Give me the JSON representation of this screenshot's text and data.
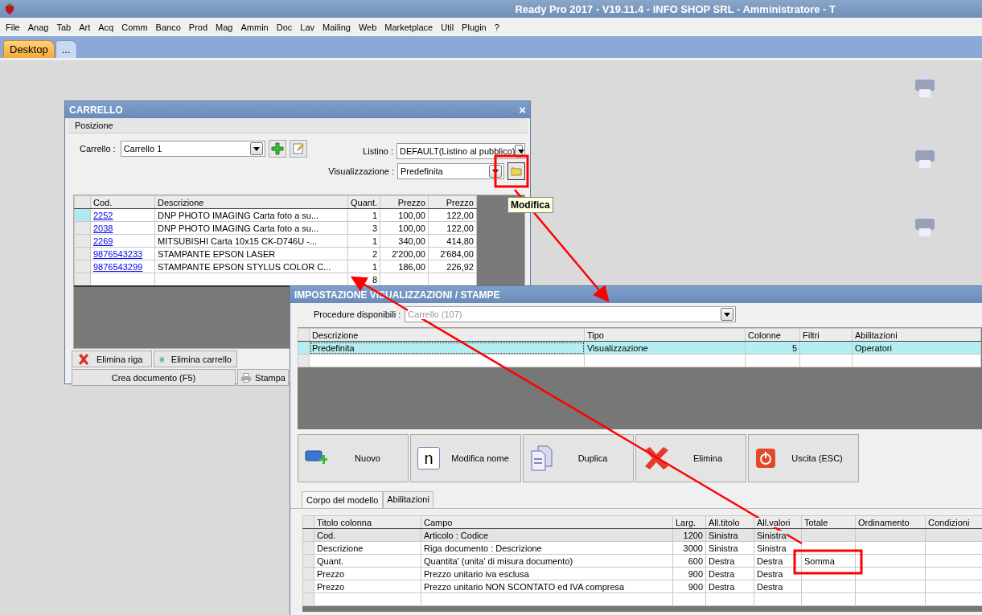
{
  "window": {
    "title": "Ready Pro 2017 - V19.11.4 - INFO SHOP SRL - Amministratore - T"
  },
  "menu": [
    "File",
    "Anag",
    "Tab",
    "Art",
    "Acq",
    "Comm",
    "Banco",
    "Prod",
    "Mag",
    "Ammin",
    "Doc",
    "Lav",
    "Mailing",
    "Web",
    "Marketplace",
    "Util",
    "Plugin",
    "?"
  ],
  "tabs": [
    {
      "label": "Desktop",
      "selected": true
    },
    {
      "label": "...",
      "selected": false
    }
  ],
  "carrello": {
    "title": "CARRELLO",
    "close": "×",
    "section": "Posizione",
    "carrello_label": "Carrello :",
    "carrello_value": "Carrello 1",
    "listino_label": "Listino :",
    "listino_value": "DEFAULT(Listino al pubblico)",
    "vis_label": "Visualizzazione :",
    "vis_value": "Predefinita",
    "columns": [
      "Cod.",
      "Descrizione",
      "Quant.",
      "Prezzo",
      "Prezzo"
    ],
    "rows": [
      {
        "selected": true,
        "cells": [
          "2252",
          "DNP PHOTO IMAGING Carta foto a su...",
          "1",
          "100,00",
          "122,00"
        ]
      },
      {
        "selected": false,
        "cells": [
          "2038",
          "DNP PHOTO IMAGING Carta foto a su...",
          "3",
          "100,00",
          "122,00"
        ]
      },
      {
        "selected": false,
        "cells": [
          "2269",
          "MITSUBISHI Carta 10x15 CK-D746U -...",
          "1",
          "340,00",
          "414,80"
        ]
      },
      {
        "selected": false,
        "cells": [
          "9876543233",
          "STAMPANTE EPSON LASER",
          "2",
          "2'200,00",
          "2'684,00"
        ]
      },
      {
        "selected": false,
        "cells": [
          "9876543299",
          "STAMPANTE EPSON STYLUS COLOR C...",
          "1",
          "186,00",
          "226,92"
        ]
      }
    ],
    "total_quantity": "8",
    "buttons": {
      "elimina_riga": "Elimina riga",
      "elimina_carrello": "Elimina carrello",
      "crea": "Crea documento (F5)",
      "stampa": "Stampa"
    }
  },
  "tooltip": "Modifica",
  "impostazione": {
    "title": "IMPOSTAZIONE VISUALIZZAZIONI / STAMPE",
    "procedure_label": "Procedure disponibili :",
    "procedure_value": "Carrello (107)",
    "columns": [
      "Descrizione",
      "Tipo",
      "Colonne",
      "Filtri",
      "Abilitazioni"
    ],
    "rows": [
      {
        "selected": true,
        "cells": [
          "Predefinita",
          "Visualizzazione",
          "5",
          "",
          "Operatori"
        ]
      }
    ],
    "buttons": [
      {
        "kind": "new",
        "label": "Nuovo"
      },
      {
        "kind": "rename",
        "label": "Modifica nome",
        "glyph": "n"
      },
      {
        "kind": "duplicate",
        "label": "Duplica"
      },
      {
        "kind": "delete",
        "label": "Elimina"
      },
      {
        "kind": "exit",
        "label": "Uscita (ESC)"
      }
    ],
    "tabs": [
      {
        "label": "Corpo del modello",
        "selected": true
      },
      {
        "label": "Abilitazioni",
        "selected": false
      }
    ],
    "body_columns": [
      "Titolo colonna",
      "Campo",
      "Larg.",
      "All.titolo",
      "All.valori",
      "Totale",
      "Ordinamento",
      "Condizioni"
    ],
    "body_rows": [
      {
        "selected": true,
        "cells": [
          "Cod.",
          "Articolo : Codice",
          "1200",
          "Sinistra",
          "Sinistra",
          "",
          "",
          ""
        ]
      },
      {
        "selected": false,
        "cells": [
          "Descrizione",
          "Riga documento : Descrizione",
          "3000",
          "Sinistra",
          "Sinistra",
          "",
          "",
          ""
        ]
      },
      {
        "selected": false,
        "cells": [
          "Quant.",
          "Quantita' (unita' di misura documento)",
          "600",
          "Destra",
          "Destra",
          "Somma",
          "",
          ""
        ]
      },
      {
        "selected": false,
        "cells": [
          "Prezzo",
          "Prezzo unitario iva esclusa",
          "900",
          "Destra",
          "Destra",
          "",
          "",
          ""
        ]
      },
      {
        "selected": false,
        "cells": [
          "Prezzo",
          "Prezzo unitario NON SCONTATO ed IVA compresa",
          "900",
          "Destra",
          "Destra",
          "",
          "",
          ""
        ]
      }
    ]
  }
}
